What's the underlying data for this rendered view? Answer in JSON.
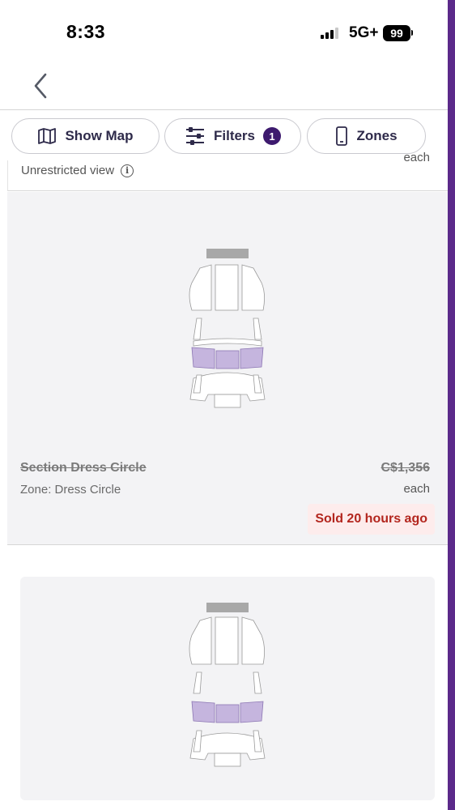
{
  "status_bar": {
    "time": "8:33",
    "network": "5G+",
    "battery": "99"
  },
  "filter_bar": {
    "show_map_label": "Show Map",
    "filters_label": "Filters",
    "filters_count": "1",
    "zones_label": "Zones"
  },
  "previous_listing": {
    "view_text": "Unrestricted view",
    "each_label": "each"
  },
  "listing": {
    "section": "Section Dress Circle",
    "zone": "Zone: Dress Circle",
    "price": "C$1,356",
    "each_label": "each",
    "sold_badge": "Sold 20 hours ago"
  },
  "colors": {
    "accent": "#3d1a6e",
    "highlight_section": "#c5b5de",
    "sold_text": "#b3261e",
    "sold_bg": "#fdecec",
    "card_bg": "#f3f3f5"
  },
  "icons": {
    "back": "chevron-left-icon",
    "map": "map-icon",
    "filters": "sliders-icon",
    "zones": "phone-icon",
    "info": "info-icon"
  }
}
